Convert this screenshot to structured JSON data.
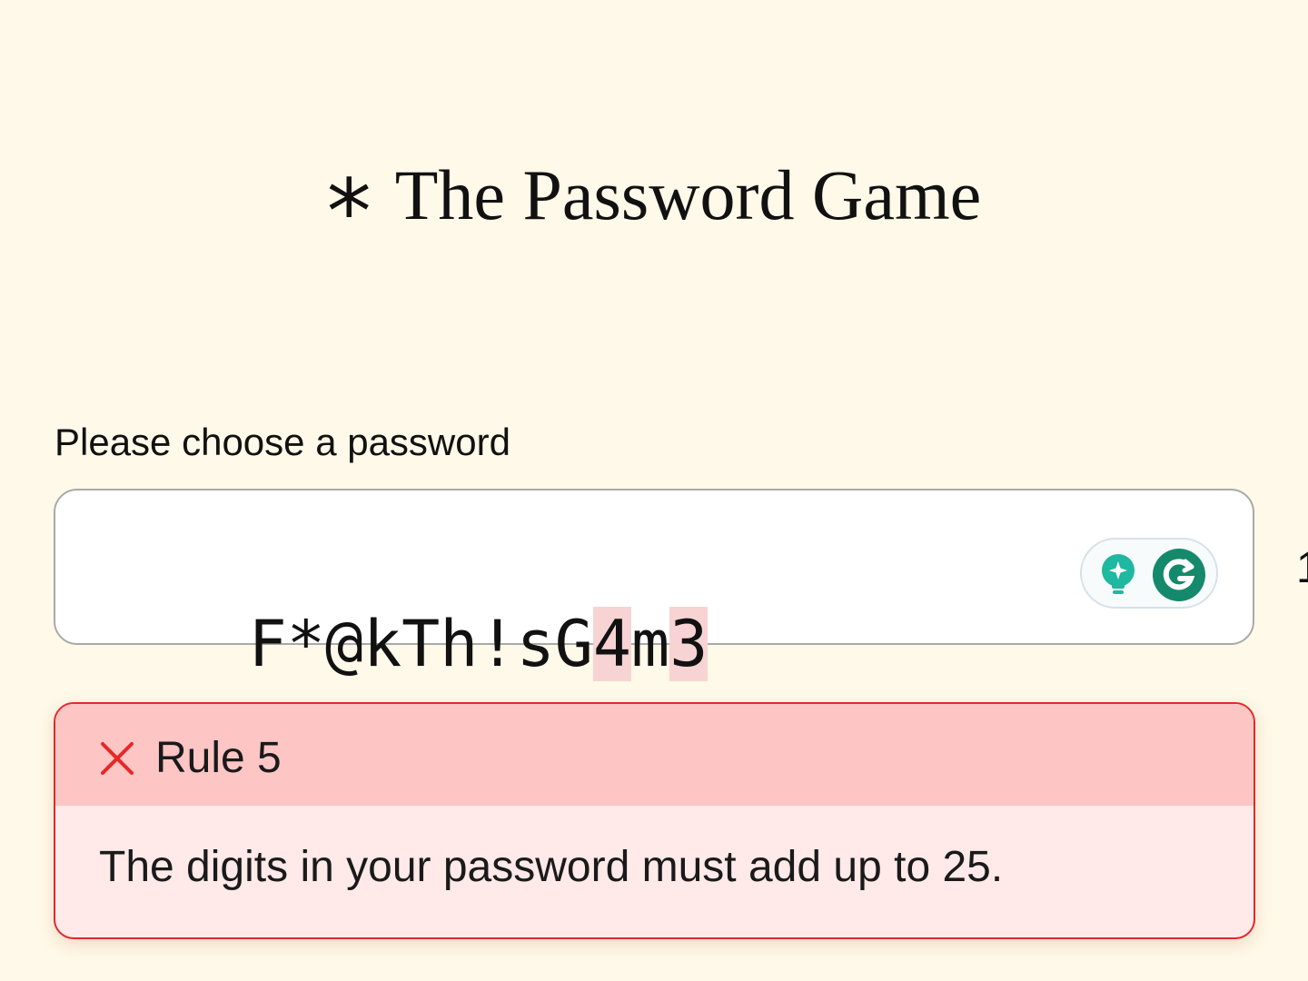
{
  "header": {
    "star": "*",
    "title": "The Password Game"
  },
  "password": {
    "label": "Please choose a password",
    "value": "F*@kTh!sG4m3",
    "segments": [
      {
        "text": "F*@kTh!sG",
        "highlight": false
      },
      {
        "text": "4",
        "highlight": true
      },
      {
        "text": "m",
        "highlight": false
      },
      {
        "text": "3",
        "highlight": true
      }
    ],
    "assistant_icons": [
      "lightbulb-icon",
      "grammarly-icon"
    ],
    "edge_text": "1"
  },
  "rule": {
    "status": "failed",
    "status_icon": "x-icon",
    "title": "Rule 5",
    "description": "The digits in your password must add up to 25."
  },
  "colors": {
    "background": "#fef9e8",
    "rule_border": "#e52828",
    "rule_header": "#fec5c5",
    "rule_body": "#ffe9e9",
    "digit_highlight": "#f8d3d3",
    "assistant_green": "#15896b",
    "bulb_teal": "#1fb8a0"
  }
}
